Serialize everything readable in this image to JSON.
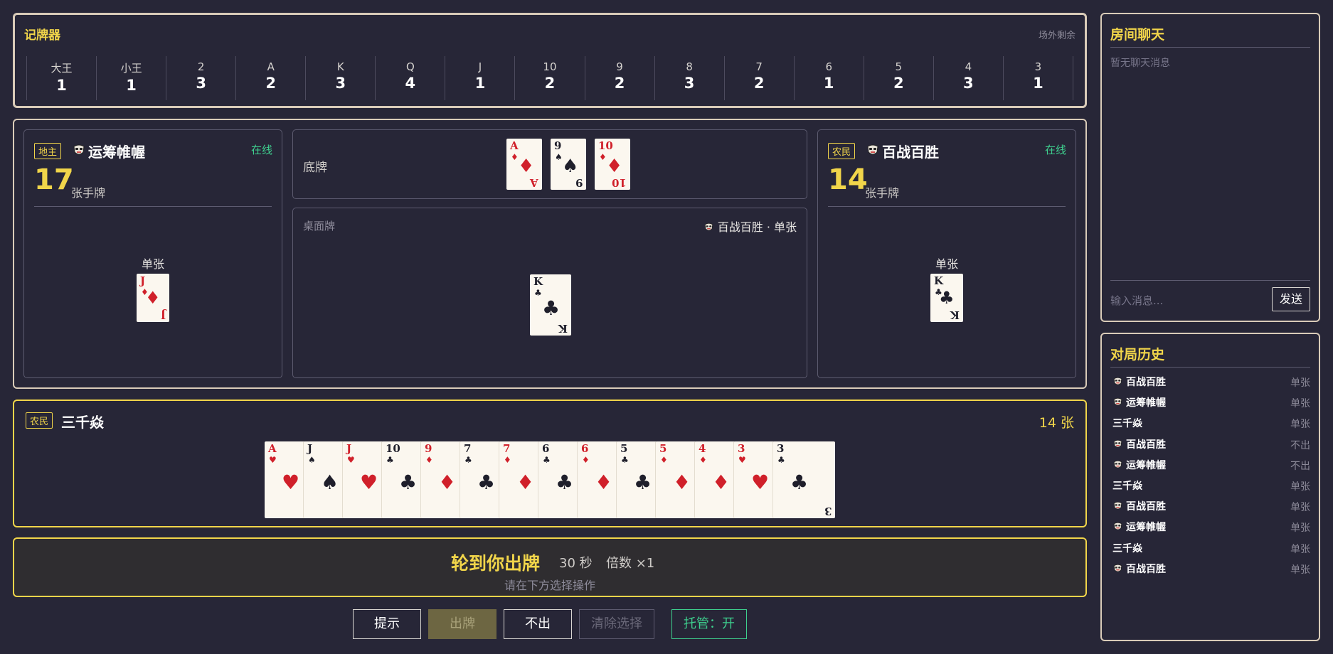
{
  "tracker": {
    "title": "记牌器",
    "subtitle": "场外剩余",
    "cells": [
      {
        "rank": "大王",
        "count": "1"
      },
      {
        "rank": "小王",
        "count": "1"
      },
      {
        "rank": "2",
        "count": "3"
      },
      {
        "rank": "A",
        "count": "2"
      },
      {
        "rank": "K",
        "count": "3"
      },
      {
        "rank": "Q",
        "count": "4"
      },
      {
        "rank": "J",
        "count": "1"
      },
      {
        "rank": "10",
        "count": "2"
      },
      {
        "rank": "9",
        "count": "2"
      },
      {
        "rank": "8",
        "count": "3"
      },
      {
        "rank": "7",
        "count": "2"
      },
      {
        "rank": "6",
        "count": "1"
      },
      {
        "rank": "5",
        "count": "2"
      },
      {
        "rank": "4",
        "count": "3"
      },
      {
        "rank": "3",
        "count": "1"
      }
    ]
  },
  "players": {
    "left": {
      "role": "地主",
      "name": "运筹帷幄",
      "status": "在线",
      "count": "17",
      "count_label": "张手牌",
      "played_label": "单张",
      "played_card": {
        "rank": "J",
        "suit": "♦",
        "color": "red"
      }
    },
    "right": {
      "role": "农民",
      "name": "百战百胜",
      "status": "在线",
      "count": "14",
      "count_label": "张手牌",
      "played_label": "单张",
      "played_card": {
        "rank": "K",
        "suit": "♣",
        "color": "black"
      }
    },
    "me": {
      "role": "农民",
      "name": "三千焱",
      "count_text": "14 张"
    }
  },
  "bottom_cards": {
    "label": "底牌",
    "cards": [
      {
        "rank": "A",
        "suit": "♦",
        "color": "red"
      },
      {
        "rank": "9",
        "suit": "♠",
        "color": "black"
      },
      {
        "rank": "10",
        "suit": "♦",
        "color": "red"
      }
    ]
  },
  "desk": {
    "label": "桌面牌",
    "player_info": "百战百胜 · 单张",
    "card": {
      "rank": "K",
      "suit": "♣",
      "color": "black"
    }
  },
  "hand": [
    {
      "rank": "A",
      "suit": "♥",
      "color": "red"
    },
    {
      "rank": "J",
      "suit": "♠",
      "color": "black"
    },
    {
      "rank": "J",
      "suit": "♥",
      "color": "red"
    },
    {
      "rank": "10",
      "suit": "♣",
      "color": "black"
    },
    {
      "rank": "9",
      "suit": "♦",
      "color": "red"
    },
    {
      "rank": "7",
      "suit": "♣",
      "color": "black"
    },
    {
      "rank": "7",
      "suit": "♦",
      "color": "red"
    },
    {
      "rank": "6",
      "suit": "♣",
      "color": "black"
    },
    {
      "rank": "6",
      "suit": "♦",
      "color": "red"
    },
    {
      "rank": "5",
      "suit": "♣",
      "color": "black"
    },
    {
      "rank": "5",
      "suit": "♦",
      "color": "red"
    },
    {
      "rank": "4",
      "suit": "♦",
      "color": "red"
    },
    {
      "rank": "3",
      "suit": "♥",
      "color": "red"
    },
    {
      "rank": "3",
      "suit": "♣",
      "color": "black"
    }
  ],
  "turn": {
    "title": "轮到你出牌",
    "timer": "30 秒",
    "multiplier": "倍数 ×1",
    "hint": "请在下方选择操作"
  },
  "actions": {
    "hint": "提示",
    "play": "出牌",
    "pass": "不出",
    "clear": "清除选择",
    "auto": "托管：开"
  },
  "chat": {
    "title": "房间聊天",
    "empty": "暂无聊天消息",
    "placeholder": "输入消息...",
    "send": "发送"
  },
  "history": {
    "title": "对局历史",
    "rows": [
      {
        "name": "百战百胜",
        "action": "单张",
        "mask": true
      },
      {
        "name": "运筹帷幄",
        "action": "单张",
        "mask": true
      },
      {
        "name": "三千焱",
        "action": "单张",
        "mask": false
      },
      {
        "name": "百战百胜",
        "action": "不出",
        "mask": true
      },
      {
        "name": "运筹帷幄",
        "action": "不出",
        "mask": true
      },
      {
        "name": "三千焱",
        "action": "单张",
        "mask": false
      },
      {
        "name": "百战百胜",
        "action": "单张",
        "mask": true
      },
      {
        "name": "运筹帷幄",
        "action": "单张",
        "mask": true
      },
      {
        "name": "三千焱",
        "action": "单张",
        "mask": false
      },
      {
        "name": "百战百胜",
        "action": "单张",
        "mask": true
      }
    ]
  },
  "colors": {
    "accent": "#f1d54a",
    "online": "#3ecf8e",
    "background": "#272637",
    "card_red": "#d0202a",
    "card_black": "#1f1f2b"
  }
}
